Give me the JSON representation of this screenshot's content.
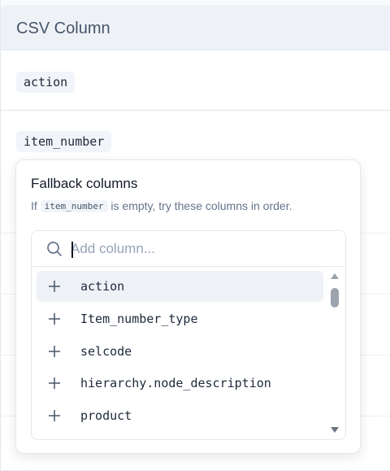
{
  "panel": {
    "header_title": "CSV Column",
    "rows": [
      {
        "column": "action"
      },
      {
        "column": "item_number"
      }
    ]
  },
  "fallback_popover": {
    "title": "Fallback columns",
    "description_prefix": "If",
    "description_code": "item_number",
    "description_suffix": "is empty, try these columns in order.",
    "search": {
      "placeholder": "Add column...",
      "value": ""
    },
    "options": [
      {
        "label": "action",
        "icon": "plus-icon",
        "highlighted": true
      },
      {
        "label": "Item_number_type",
        "icon": "plus-icon",
        "highlighted": false
      },
      {
        "label": "selcode",
        "icon": "plus-icon",
        "highlighted": false
      },
      {
        "label": "hierarchy.node_description",
        "icon": "plus-icon",
        "highlighted": false
      },
      {
        "label": "product",
        "icon": "plus-icon",
        "highlighted": false
      }
    ]
  },
  "colors": {
    "header_bg": "#eef2f7",
    "chip_bg": "#f1f5f9",
    "hover_bg": "#eef2f7",
    "text_muted": "#64748b"
  }
}
